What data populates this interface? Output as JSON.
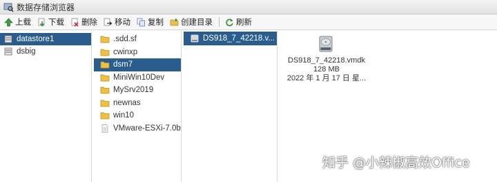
{
  "window": {
    "title": "数据存储浏览器"
  },
  "toolbar": {
    "buttons": [
      {
        "label": "上载",
        "icon": "upload-icon"
      },
      {
        "label": "下载",
        "icon": "download-icon"
      },
      {
        "label": "删除",
        "icon": "delete-icon"
      },
      {
        "label": "移动",
        "icon": "move-icon"
      },
      {
        "label": "复制",
        "icon": "copy-icon"
      },
      {
        "label": "创建目录",
        "icon": "create-folder-icon"
      },
      {
        "label": "刷新",
        "icon": "refresh-icon"
      }
    ]
  },
  "datastores": [
    {
      "label": "datastore1",
      "selected": true
    },
    {
      "label": "dsbig",
      "selected": false
    }
  ],
  "folders": [
    {
      "label": ".sdd.sf",
      "selected": false,
      "type": "folder"
    },
    {
      "label": "cwinxp",
      "selected": false,
      "type": "folder"
    },
    {
      "label": "dsm7",
      "selected": true,
      "type": "folder"
    },
    {
      "label": "MiniWin10Dev",
      "selected": false,
      "type": "folder"
    },
    {
      "label": "MySrv2019",
      "selected": false,
      "type": "folder"
    },
    {
      "label": "newnas",
      "selected": false,
      "type": "folder"
    },
    {
      "label": "win10",
      "selected": false,
      "type": "folder"
    },
    {
      "label": "VMware-ESXi-7.0b...",
      "selected": false,
      "type": "file"
    }
  ],
  "files": [
    {
      "label": "DS918_7_42218.v...",
      "selected": true
    }
  ],
  "detail": {
    "name": "DS918_7_42218.vmdk",
    "size": "128 MB",
    "date": "2022 年 1 月 17 日 星..."
  },
  "watermark": "知乎 @小辣椒高效Office",
  "colors": {
    "selection": "#2a5d8f",
    "folder": "#f0c040"
  }
}
